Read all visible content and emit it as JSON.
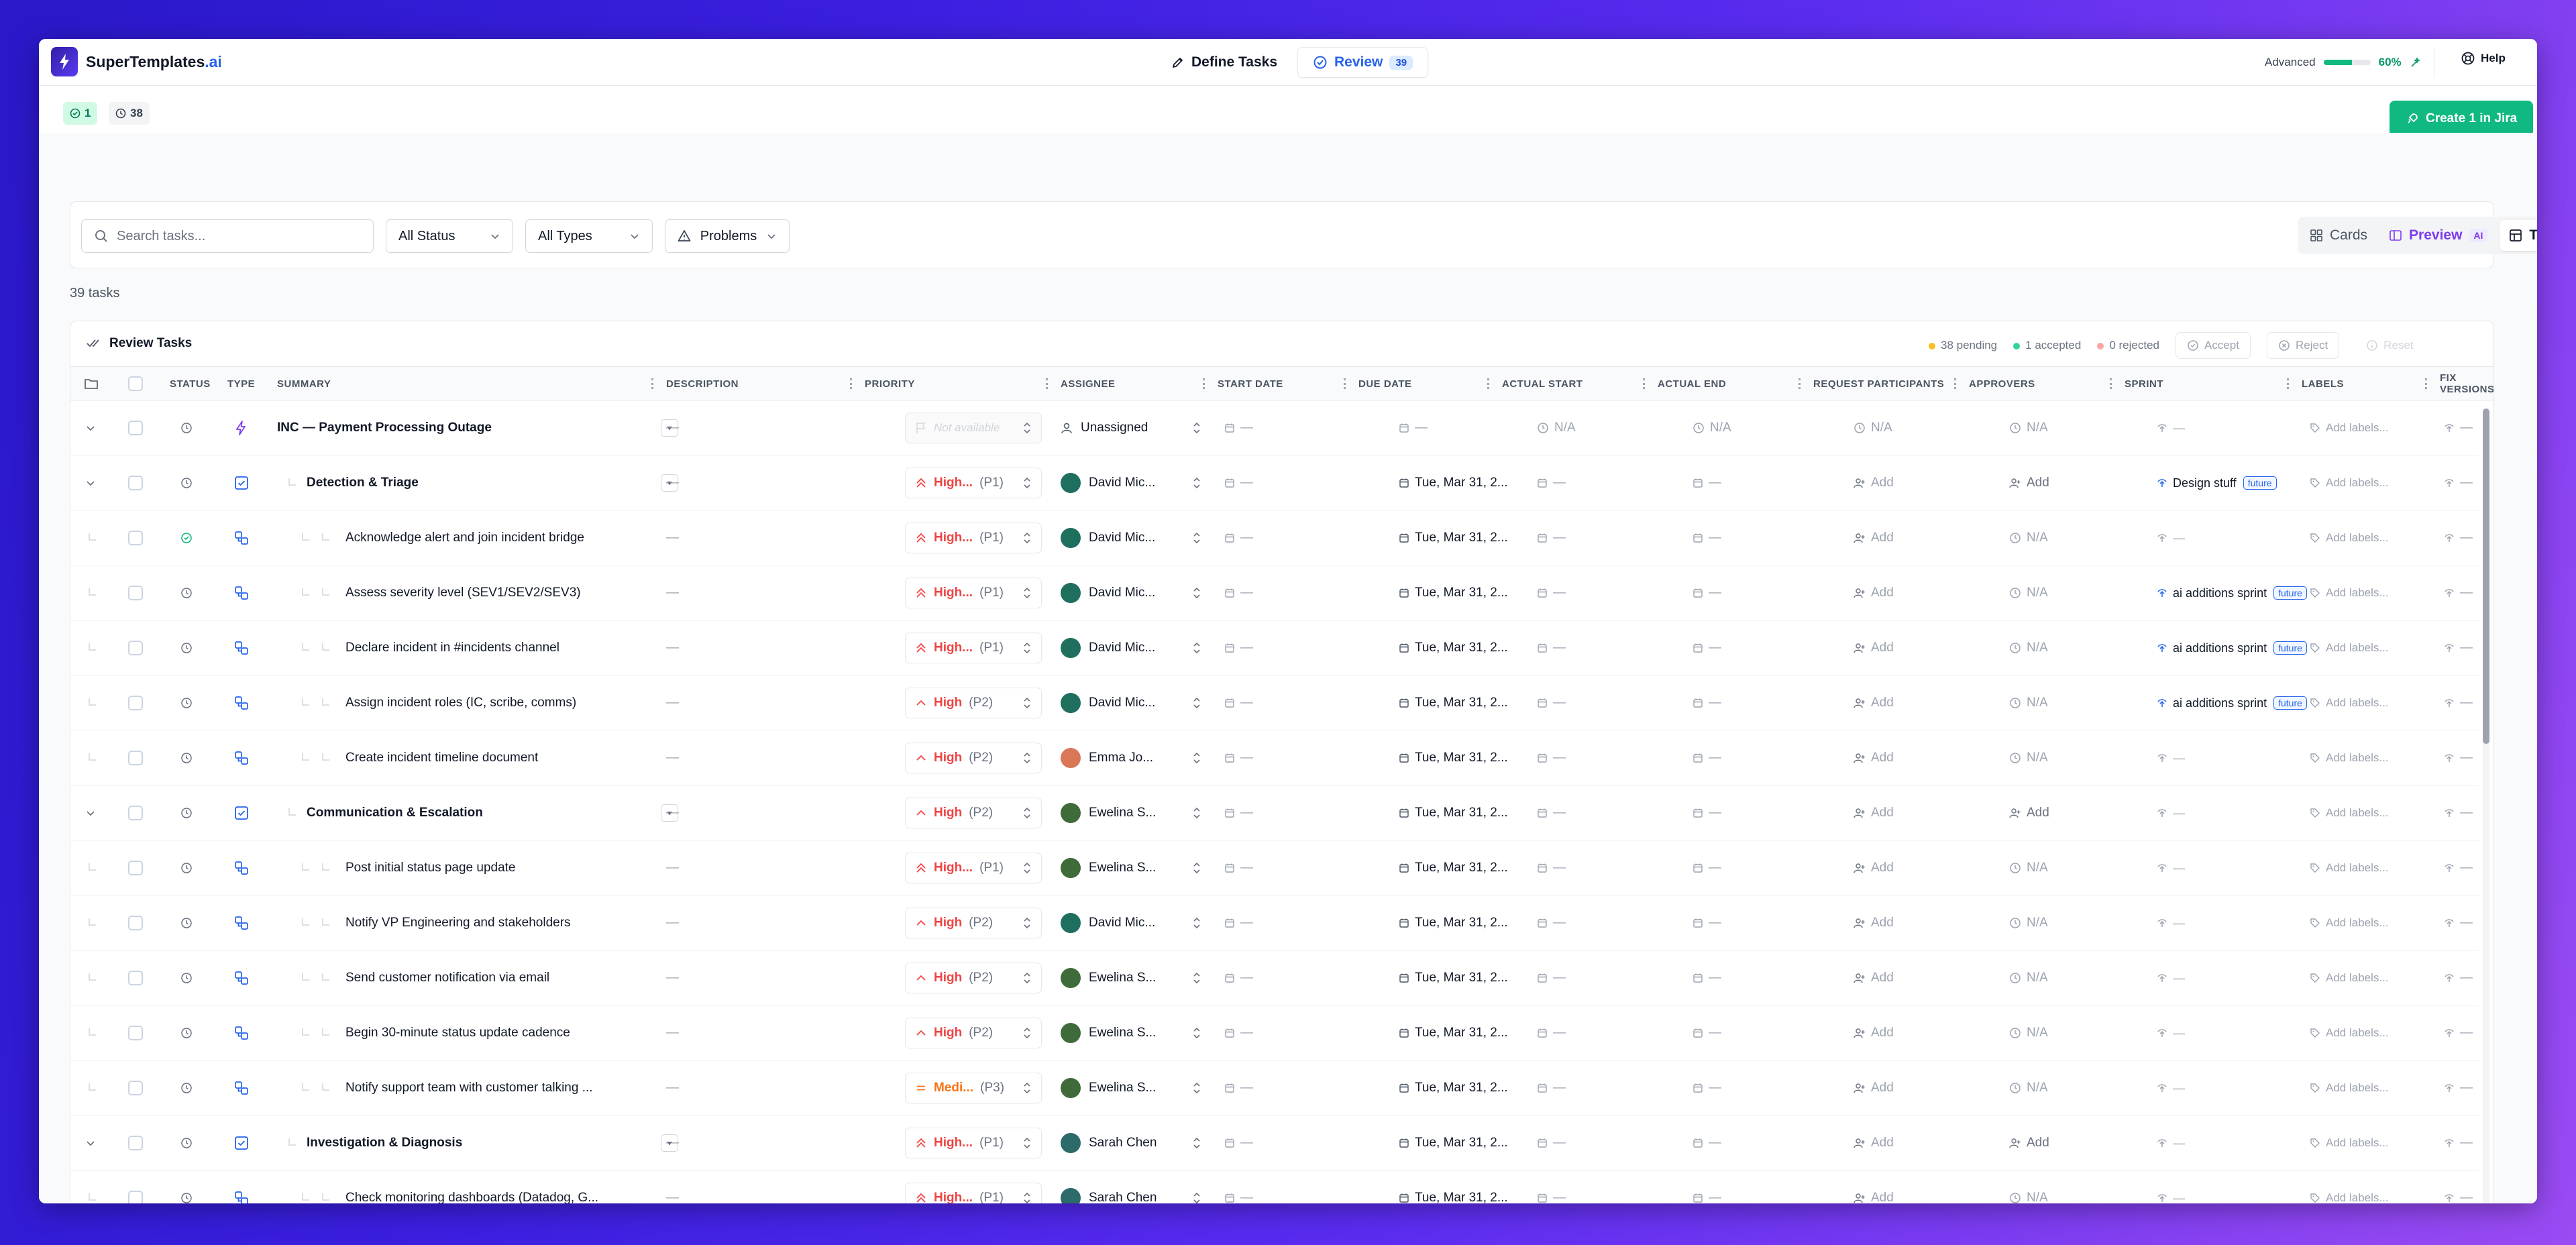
{
  "app": {
    "logo_text": "SuperTemplates",
    "logo_accent": ".ai"
  },
  "nav": {
    "define_label": "Define Tasks",
    "review_label": "Review",
    "review_count": "39"
  },
  "mode": {
    "label": "Advanced",
    "percent": "60%",
    "fraction": 0.6
  },
  "help_label": "Help",
  "chips": {
    "accepted": "1",
    "pending": "38"
  },
  "jira_button": "Create 1 in Jira",
  "filters": {
    "search_placeholder": "Search tasks...",
    "status": "All Status",
    "types": "All Types",
    "problems": "Problems"
  },
  "views": {
    "cards": "Cards",
    "preview": "Preview",
    "ai_badge": "AI",
    "table": "Table"
  },
  "task_count": "39 tasks",
  "review": {
    "title": "Review Tasks",
    "pending": "38 pending",
    "accepted": "1 accepted",
    "rejected": "0 rejected",
    "accept": "Accept",
    "reject": "Reject",
    "reset": "Reset"
  },
  "columns": [
    "STATUS",
    "TYPE",
    "SUMMARY",
    "DESCRIPTION",
    "PRIORITY",
    "ASSIGNEE",
    "START DATE",
    "DUE DATE",
    "ACTUAL START",
    "ACTUAL END",
    "REQUEST PARTICIPANTS",
    "APPROVERS",
    "SPRINT",
    "LABELS",
    "FIX VERSIONS"
  ],
  "colors": {
    "brand": "#2563eb",
    "success": "#10b981",
    "high": "#ef4444",
    "medium": "#f97316",
    "ai": "#7c3aed"
  },
  "rows": [
    {
      "level": 0,
      "type": "epic",
      "status": "pending",
      "summary": "INC — Payment Processing Outage",
      "description": "—",
      "priority": "Not available",
      "priority_code": "",
      "assignee": "Unassigned",
      "start": "—",
      "due": "—",
      "actual_start": "N/A",
      "actual_end": "N/A",
      "participants": "N/A",
      "approvers": "N/A",
      "sprint": "—",
      "sprint_tag": "",
      "labels": "Add labels...",
      "fix": "—"
    },
    {
      "level": 1,
      "type": "task",
      "status": "pending",
      "summary": "Detection & Triage",
      "description": "—",
      "priority": "High...",
      "priority_code": "(P1)",
      "assignee": "David Mic...",
      "start": "—",
      "due": "Tue, Mar 31, 2...",
      "actual_start": "—",
      "actual_end": "—",
      "participants": "Add",
      "approvers": "Add",
      "sprint": "Design stuff",
      "sprint_tag": "future",
      "labels": "Add labels...",
      "fix": "—"
    },
    {
      "level": 2,
      "type": "subtask",
      "status": "accepted",
      "summary": "Acknowledge alert and join incident bridge",
      "description": "—",
      "priority": "High...",
      "priority_code": "(P1)",
      "assignee": "David Mic...",
      "start": "—",
      "due": "Tue, Mar 31, 2...",
      "actual_start": "—",
      "actual_end": "—",
      "participants": "Add",
      "approvers": "N/A",
      "sprint": "—",
      "sprint_tag": "",
      "labels": "Add labels...",
      "fix": "—"
    },
    {
      "level": 2,
      "type": "subtask",
      "status": "pending",
      "summary": "Assess severity level (SEV1/SEV2/SEV3)",
      "description": "—",
      "priority": "High...",
      "priority_code": "(P1)",
      "assignee": "David Mic...",
      "start": "—",
      "due": "Tue, Mar 31, 2...",
      "actual_start": "—",
      "actual_end": "—",
      "participants": "Add",
      "approvers": "N/A",
      "sprint": "ai additions sprint",
      "sprint_tag": "future",
      "labels": "Add labels...",
      "fix": "—"
    },
    {
      "level": 2,
      "type": "subtask",
      "status": "pending",
      "summary": "Declare incident in #incidents channel",
      "description": "—",
      "priority": "High...",
      "priority_code": "(P1)",
      "assignee": "David Mic...",
      "start": "—",
      "due": "Tue, Mar 31, 2...",
      "actual_start": "—",
      "actual_end": "—",
      "participants": "Add",
      "approvers": "N/A",
      "sprint": "ai additions sprint",
      "sprint_tag": "future",
      "labels": "Add labels...",
      "fix": "—"
    },
    {
      "level": 2,
      "type": "subtask",
      "status": "pending",
      "summary": "Assign incident roles (IC, scribe, comms)",
      "description": "—",
      "priority": "High",
      "priority_code": "(P2)",
      "assignee": "David Mic...",
      "start": "—",
      "due": "Tue, Mar 31, 2...",
      "actual_start": "—",
      "actual_end": "—",
      "participants": "Add",
      "approvers": "N/A",
      "sprint": "ai additions sprint",
      "sprint_tag": "future",
      "labels": "Add labels...",
      "fix": "—"
    },
    {
      "level": 2,
      "type": "subtask",
      "status": "pending",
      "summary": "Create incident timeline document",
      "description": "—",
      "priority": "High",
      "priority_code": "(P2)",
      "assignee": "Emma Jo...",
      "start": "—",
      "due": "Tue, Mar 31, 2...",
      "actual_start": "—",
      "actual_end": "—",
      "participants": "Add",
      "approvers": "N/A",
      "sprint": "—",
      "sprint_tag": "",
      "labels": "Add labels...",
      "fix": "—"
    },
    {
      "level": 1,
      "type": "task",
      "status": "pending",
      "summary": "Communication & Escalation",
      "description": "—",
      "priority": "High",
      "priority_code": "(P2)",
      "assignee": "Ewelina S...",
      "start": "—",
      "due": "Tue, Mar 31, 2...",
      "actual_start": "—",
      "actual_end": "—",
      "participants": "Add",
      "approvers": "Add",
      "sprint": "—",
      "sprint_tag": "",
      "labels": "Add labels...",
      "fix": "—"
    },
    {
      "level": 2,
      "type": "subtask",
      "status": "pending",
      "summary": "Post initial status page update",
      "description": "—",
      "priority": "High...",
      "priority_code": "(P1)",
      "assignee": "Ewelina S...",
      "start": "—",
      "due": "Tue, Mar 31, 2...",
      "actual_start": "—",
      "actual_end": "—",
      "participants": "Add",
      "approvers": "N/A",
      "sprint": "—",
      "sprint_tag": "",
      "labels": "Add labels...",
      "fix": "—"
    },
    {
      "level": 2,
      "type": "subtask",
      "status": "pending",
      "summary": "Notify VP Engineering and stakeholders",
      "description": "—",
      "priority": "High",
      "priority_code": "(P2)",
      "assignee": "David Mic...",
      "start": "—",
      "due": "Tue, Mar 31, 2...",
      "actual_start": "—",
      "actual_end": "—",
      "participants": "Add",
      "approvers": "N/A",
      "sprint": "—",
      "sprint_tag": "",
      "labels": "Add labels...",
      "fix": "—"
    },
    {
      "level": 2,
      "type": "subtask",
      "status": "pending",
      "summary": "Send customer notification via email",
      "description": "—",
      "priority": "High",
      "priority_code": "(P2)",
      "assignee": "Ewelina S...",
      "start": "—",
      "due": "Tue, Mar 31, 2...",
      "actual_start": "—",
      "actual_end": "—",
      "participants": "Add",
      "approvers": "N/A",
      "sprint": "—",
      "sprint_tag": "",
      "labels": "Add labels...",
      "fix": "—"
    },
    {
      "level": 2,
      "type": "subtask",
      "status": "pending",
      "summary": "Begin 30-minute status update cadence",
      "description": "—",
      "priority": "High",
      "priority_code": "(P2)",
      "assignee": "Ewelina S...",
      "start": "—",
      "due": "Tue, Mar 31, 2...",
      "actual_start": "—",
      "actual_end": "—",
      "participants": "Add",
      "approvers": "N/A",
      "sprint": "—",
      "sprint_tag": "",
      "labels": "Add labels...",
      "fix": "—"
    },
    {
      "level": 2,
      "type": "subtask",
      "status": "pending",
      "summary": "Notify support team with customer talking ...",
      "description": "—",
      "priority": "Medi...",
      "priority_code": "(P3)",
      "assignee": "Ewelina S...",
      "start": "—",
      "due": "Tue, Mar 31, 2...",
      "actual_start": "—",
      "actual_end": "—",
      "participants": "Add",
      "approvers": "N/A",
      "sprint": "—",
      "sprint_tag": "",
      "labels": "Add labels...",
      "fix": "—"
    },
    {
      "level": 1,
      "type": "task",
      "status": "pending",
      "summary": "Investigation & Diagnosis",
      "description": "—",
      "priority": "High...",
      "priority_code": "(P1)",
      "assignee": "Sarah Chen",
      "start": "—",
      "due": "Tue, Mar 31, 2...",
      "actual_start": "—",
      "actual_end": "—",
      "participants": "Add",
      "approvers": "Add",
      "sprint": "—",
      "sprint_tag": "",
      "labels": "Add labels...",
      "fix": "—"
    },
    {
      "level": 2,
      "type": "subtask",
      "status": "pending",
      "summary": "Check monitoring dashboards (Datadog, G...",
      "description": "—",
      "priority": "High...",
      "priority_code": "(P1)",
      "assignee": "Sarah Chen",
      "start": "—",
      "due": "Tue, Mar 31, 2...",
      "actual_start": "—",
      "actual_end": "—",
      "participants": "Add",
      "approvers": "N/A",
      "sprint": "—",
      "sprint_tag": "",
      "labels": "Add labels...",
      "fix": "—"
    }
  ]
}
